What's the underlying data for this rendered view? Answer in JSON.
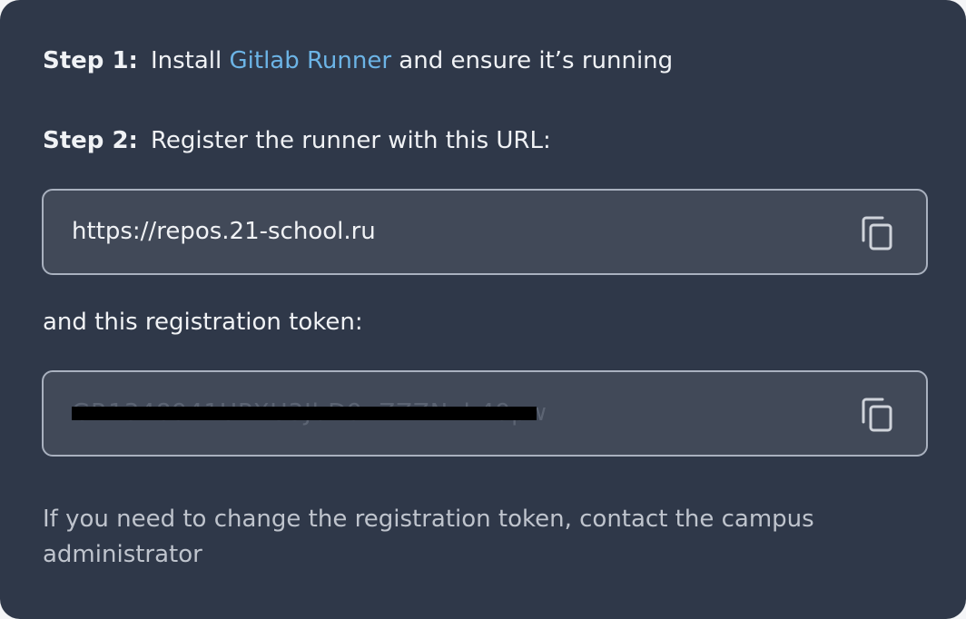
{
  "step1": {
    "label": "Step 1:",
    "text_before": "Install",
    "link_text": "Gitlab Runner",
    "text_after": "and ensure it’s running"
  },
  "step2": {
    "label": "Step 2:",
    "text": "Register the runner with this URL:"
  },
  "url_field": {
    "value": "https://repos.21-school.ru",
    "copy_icon": "copy-icon"
  },
  "token_label": "and this registration token:",
  "token_field": {
    "value": "GR1348941UPXU3JbD9nZZZNxh49pw",
    "redacted": true,
    "copy_icon": "copy-icon"
  },
  "note": "If you need to change the registration token, contact the campus administrator",
  "colors": {
    "panel_background": "#2f3849",
    "field_background": "#414958",
    "field_border": "#a9b1bf",
    "link": "#6cb4e6",
    "text": "#f0f2f5",
    "muted_text": "#bfc4cd"
  }
}
